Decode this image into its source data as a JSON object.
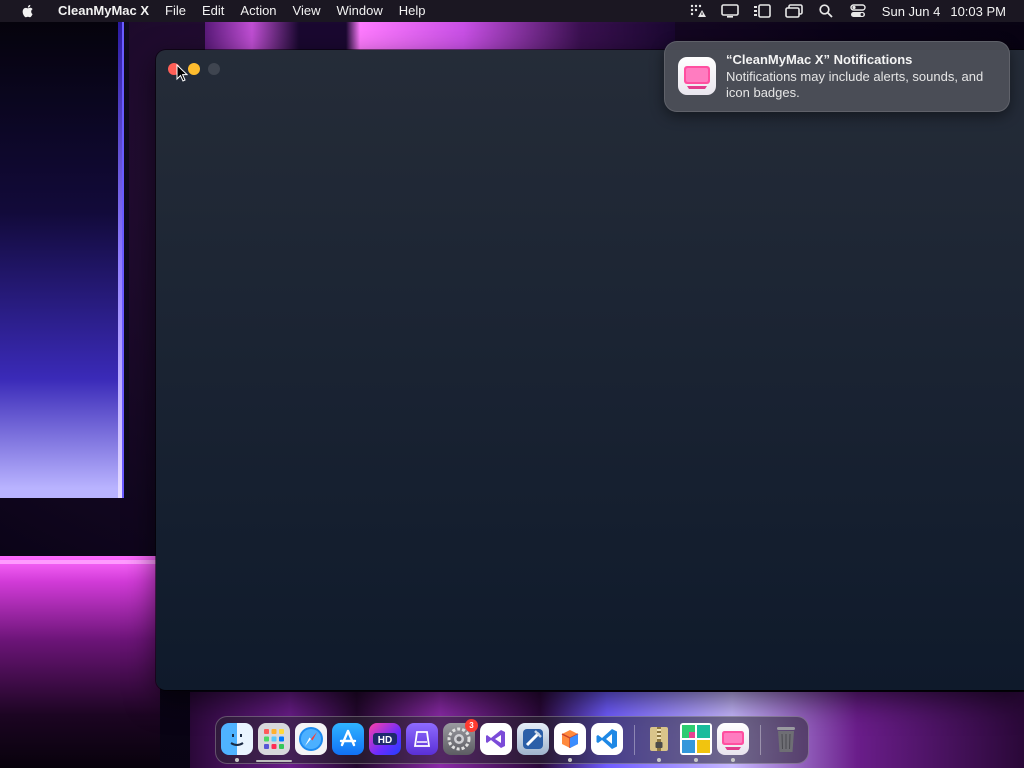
{
  "menubar": {
    "app_name": "CleanMyMac X",
    "items": [
      "File",
      "Edit",
      "Action",
      "View",
      "Window",
      "Help"
    ],
    "status_icons": [
      "grid-warning-icon",
      "display-icon",
      "stage-manager-icon",
      "screen-mirroring-icon",
      "search-icon",
      "control-center-icon"
    ],
    "date": "Sun Jun 4",
    "time": "10:03 PM"
  },
  "window": {
    "buttons": [
      "close",
      "minimize",
      "zoom"
    ]
  },
  "notification": {
    "title": "“CleanMyMac X” Notifications",
    "body": "Notifications may include alerts, sounds, and icon badges."
  },
  "dock": {
    "apps": [
      {
        "name": "Finder",
        "icon": "finder-icon",
        "running": true
      },
      {
        "name": "Launchpad",
        "icon": "launchpad-icon",
        "running": false
      },
      {
        "name": "Safari",
        "icon": "safari-icon",
        "running": false
      },
      {
        "name": "App Store",
        "icon": "app-store-icon",
        "running": false
      },
      {
        "name": "HD",
        "icon": "hd-app-icon",
        "running": false
      },
      {
        "name": "Podcasts",
        "icon": "app-icon-purple",
        "running": false
      },
      {
        "name": "System Settings",
        "icon": "settings-icon",
        "running": false,
        "badge": "3"
      },
      {
        "name": "Visual Studio",
        "icon": "visual-studio-icon",
        "running": false
      },
      {
        "name": "Xcode",
        "icon": "xcode-icon",
        "running": false
      },
      {
        "name": "Archive",
        "icon": "archive-box-icon",
        "running": true
      },
      {
        "name": "VS Code",
        "icon": "vscode-icon",
        "running": false
      },
      {
        "name": "Archive Utility",
        "icon": "zip-archive-icon",
        "running": true
      },
      {
        "name": "Grid App",
        "icon": "grid-app-icon",
        "running": true
      },
      {
        "name": "CleanMyMac X",
        "icon": "cleanmymac-icon",
        "running": true
      },
      {
        "name": "Trash",
        "icon": "trash-icon",
        "running": false
      }
    ]
  },
  "colors": {
    "close": "#ff5f57",
    "minimize": "#febc2e",
    "badge": "#ff3b30",
    "cleanmymac_pink": "#ff4fa0"
  }
}
